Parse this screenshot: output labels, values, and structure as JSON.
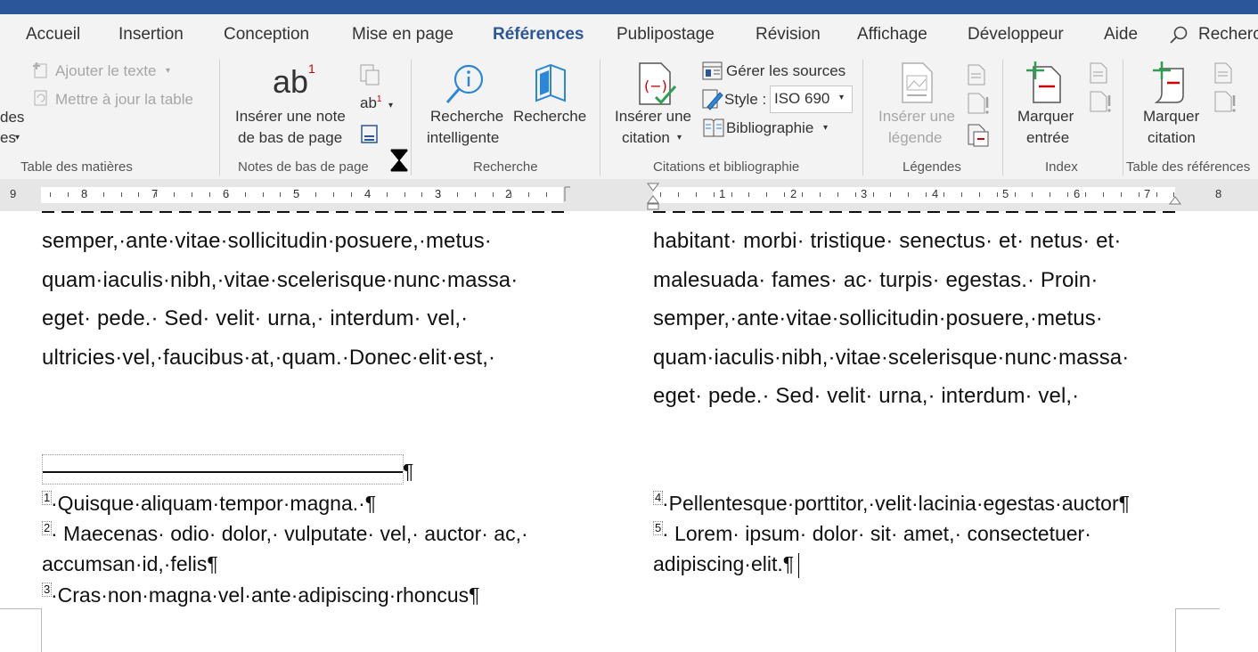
{
  "tabs": [
    "Accueil",
    "Insertion",
    "Conception",
    "Mise en page",
    "Références",
    "Publipostage",
    "Révision",
    "Affichage",
    "Développeur",
    "Aide",
    "Recherc"
  ],
  "ribbon": {
    "toc": {
      "add_text": "Ajouter le texte",
      "update_table": "Mettre à jour la table",
      "partial_1": "des",
      "partial_2": "es",
      "label": "Table des matières"
    },
    "footnotes": {
      "insert_line1": "Insérer une note",
      "insert_line2": "de bas de page",
      "label": "Notes de bas de page"
    },
    "research": {
      "smart_line1": "Recherche",
      "smart_line2": "intelligente",
      "researcher": "Recherche",
      "label": "Recherche"
    },
    "citations": {
      "insert_line1": "Insérer une",
      "insert_line2": "citation",
      "manage": "Gérer les sources",
      "style_label": "Style :",
      "style_value": "ISO 690",
      "bibliography": "Bibliographie",
      "label": "Citations et bibliographie"
    },
    "captions": {
      "insert_line1": "Insérer une",
      "insert_line2": "légende",
      "label": "Légendes"
    },
    "index": {
      "mark_line1": "Marquer",
      "mark_line2": "entrée",
      "label": "Index"
    },
    "toa": {
      "mark_line1": "Marquer",
      "mark_line2": "citation",
      "label": "Table des références"
    }
  },
  "ruler": {
    "left_numbers": [
      "9",
      "8",
      "7",
      "6",
      "5",
      "4",
      "3",
      "2"
    ],
    "right_numbers": [
      "1",
      "2",
      "3",
      "4",
      "5",
      "6",
      "7",
      "8"
    ]
  },
  "document": {
    "left_column": [
      "semper,·ante·vitae·sollicitudin·posuere,·metus·",
      "quam·iaculis·nibh,·vitae·scelerisque·nunc·massa·",
      "eget· pede.· Sed· velit· urna,· interdum· vel,·",
      "ultricies·vel,·faucibus·at,·quam.·Donec·elit·est,·"
    ],
    "right_column": [
      "habitant· morbi· tristique· senectus· et· netus· et·",
      "malesuada· fames· ac· turpis· egestas.· Proin·",
      "semper,·ante·vitae·sollicitudin·posuere,·metus·",
      "quam·iaculis·nibh,·vitae·scelerisque·nunc·massa·",
      "eget· pede.· Sed· velit· urna,· interdum· vel,·"
    ],
    "separator_mark": "¶",
    "left_footnotes": [
      {
        "num": "1",
        "text": "·Quisque·aliquam·tempor·magna.·¶"
      },
      {
        "num": "2",
        "text": "· Maecenas· odio· dolor,· vulputate· vel,· auctor· ac,·"
      },
      {
        "num": "",
        "text": "accumsan·id,·felis¶"
      },
      {
        "num": "3",
        "text": "·Cras·non·magna·vel·ante·adipiscing·rhoncus¶"
      }
    ],
    "right_footnotes": [
      {
        "num": "4",
        "text": "·Pellentesque·porttitor,·velit·lacinia·egestas·auctor¶"
      },
      {
        "num": "5",
        "text": "· Lorem· ipsum· dolor· sit· amet,· consectetuer·"
      },
      {
        "num": "",
        "text": "adipiscing·elit.¶"
      }
    ]
  }
}
